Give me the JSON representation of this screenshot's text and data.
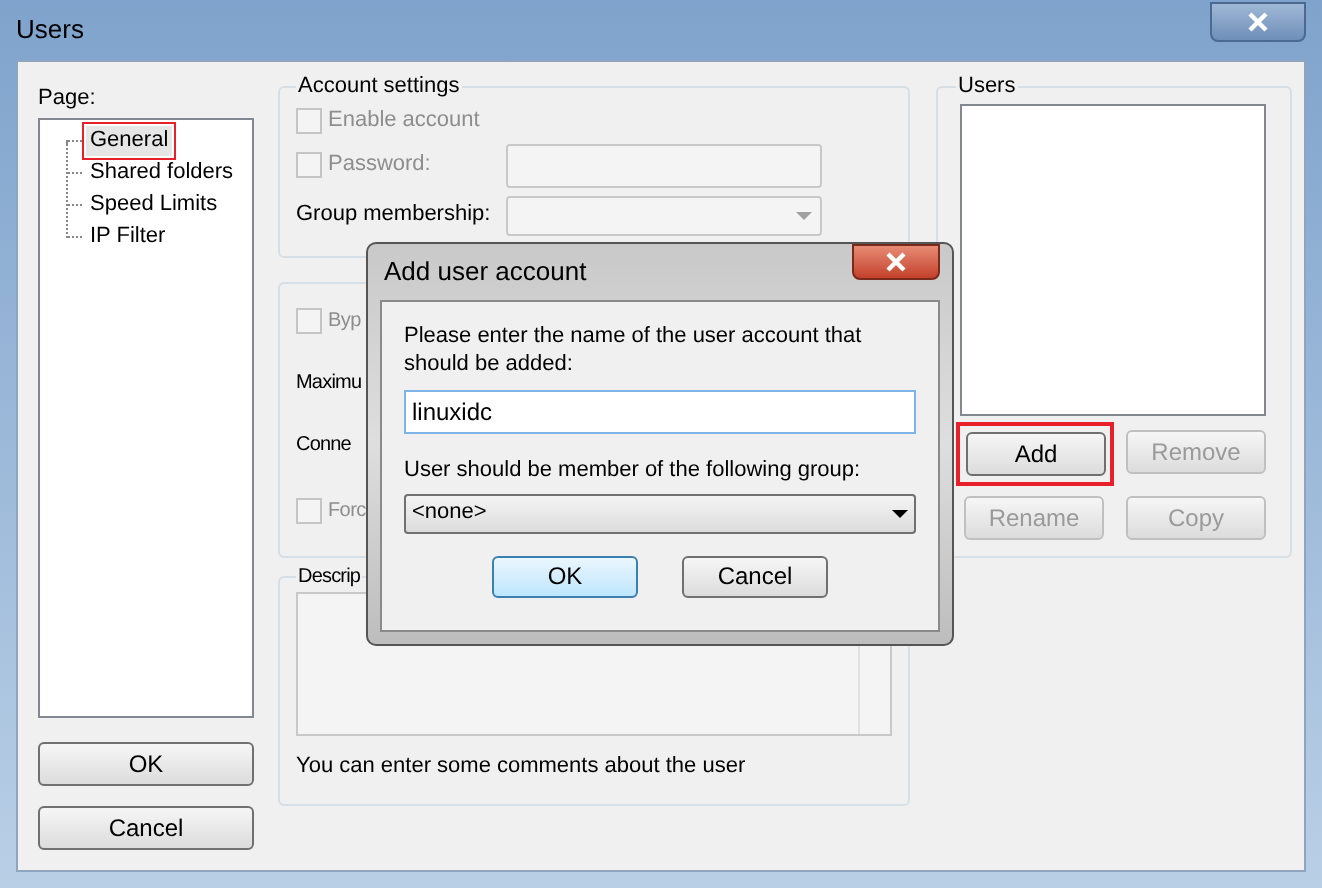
{
  "window": {
    "title": "Users"
  },
  "page_tree": {
    "label": "Page:",
    "items": [
      {
        "label": "General",
        "selected": true,
        "annotated": true
      },
      {
        "label": "Shared folders",
        "selected": false,
        "annotated": false
      },
      {
        "label": "Speed Limits",
        "selected": false,
        "annotated": false
      },
      {
        "label": "IP Filter",
        "selected": false,
        "annotated": false
      }
    ]
  },
  "buttons": [
    {
      "label": "OK"
    },
    {
      "label": "Cancel"
    }
  ],
  "account_settings": {
    "title": "Account settings",
    "enable_account": {
      "label": "Enable account",
      "checked": false,
      "disabled": true
    },
    "password": {
      "label": "Password:",
      "checked": false,
      "disabled": true
    },
    "group_membership": {
      "label": "Group membership:",
      "disabled": true
    }
  },
  "limits_group": {
    "items": [
      {
        "kind": "checkbox",
        "label": "Byp",
        "checked": false,
        "disabled": true
      },
      {
        "kind": "text",
        "label": "Maximu"
      },
      {
        "kind": "text",
        "label": "Conne"
      },
      {
        "kind": "checkbox",
        "label": "Forc",
        "checked": false,
        "disabled": true
      }
    ]
  },
  "description": {
    "title": "Descrip",
    "hint": "You can enter some comments about the user"
  },
  "users": {
    "title": "Users",
    "buttons": [
      {
        "label": "Add",
        "disabled": false,
        "annotated": true
      },
      {
        "label": "Remove",
        "disabled": true,
        "annotated": false
      },
      {
        "label": "Rename",
        "disabled": true,
        "annotated": false
      },
      {
        "label": "Copy",
        "disabled": true,
        "annotated": false
      }
    ]
  },
  "dialog": {
    "title": "Add user account",
    "prompt": "Please enter the name of the user account that should be added:",
    "name_value": "linuxidc",
    "group_label": "User should be member of the following group:",
    "group_value": "<none>",
    "buttons": [
      {
        "label": "OK",
        "focused": true
      },
      {
        "label": "Cancel",
        "focused": false
      }
    ]
  }
}
